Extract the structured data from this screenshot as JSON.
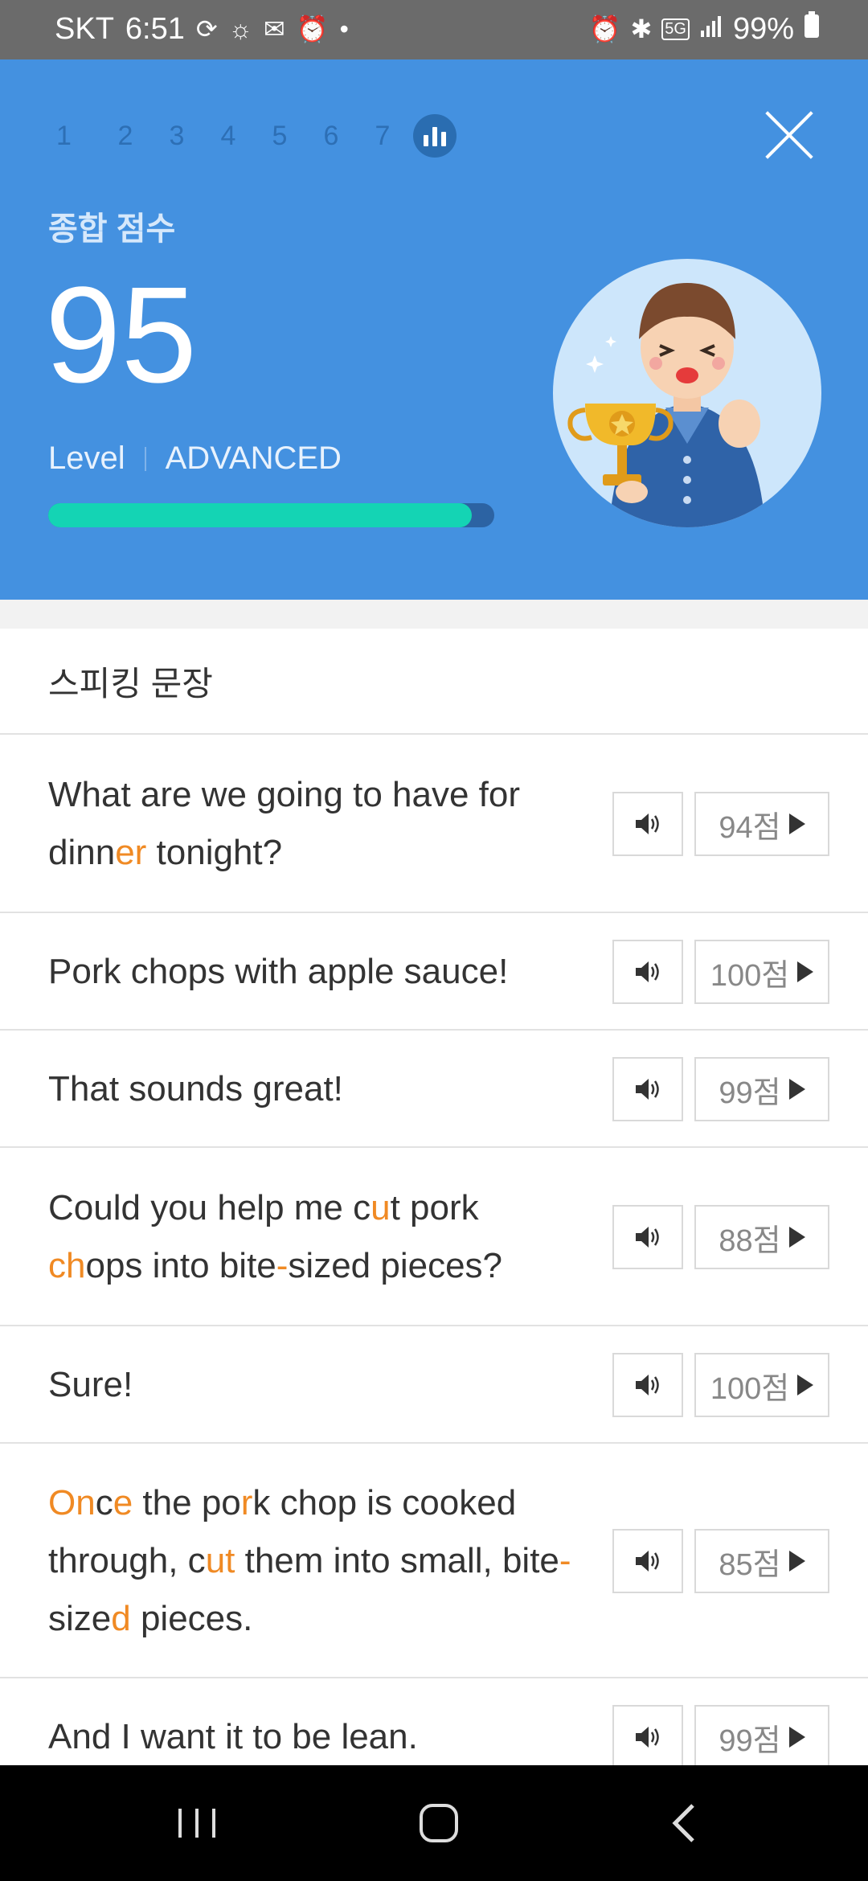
{
  "status_bar": {
    "carrier": "SKT",
    "time": "6:51",
    "battery": "99%",
    "network": "5G",
    "left_icons": [
      "sync-icon",
      "brightness-icon",
      "mail-icon",
      "alarm-icon",
      "dot-icon"
    ],
    "right_icons": [
      "alarm-icon",
      "bluetooth-icon",
      "5g-icon",
      "signal-icon",
      "battery-icon"
    ]
  },
  "hero": {
    "steps": [
      "1",
      "2",
      "3",
      "4",
      "5",
      "6",
      "7"
    ],
    "score_title": "종합 점수",
    "score": "95",
    "level_label": "Level",
    "level_value": "ADVANCED",
    "progress_fraction": 0.95,
    "colors": {
      "background": "#4491e0",
      "progress": "#14d4b4",
      "track": "#2c63a3"
    }
  },
  "section_title": "스피킹 문장",
  "sentences": [
    {
      "segments": [
        {
          "t": "What are we going to have for dinn"
        },
        {
          "t": "er",
          "h": true
        },
        {
          "t": " tonight?"
        }
      ],
      "score": "94점"
    },
    {
      "segments": [
        {
          "t": "Pork chops with apple sauce!"
        }
      ],
      "score": "100점"
    },
    {
      "segments": [
        {
          "t": "That sounds great!"
        }
      ],
      "score": "99점"
    },
    {
      "segments": [
        {
          "t": "Could you help me c"
        },
        {
          "t": "u",
          "h": true
        },
        {
          "t": "t pork "
        },
        {
          "t": "ch",
          "h": true
        },
        {
          "t": "ops into bite"
        },
        {
          "t": "-",
          "h": true
        },
        {
          "t": "sized pieces?"
        }
      ],
      "score": "88점"
    },
    {
      "segments": [
        {
          "t": "Sure!"
        }
      ],
      "score": "100점"
    },
    {
      "segments": [
        {
          "t": "O",
          "h": true
        },
        {
          "t": "n",
          "h": true
        },
        {
          "t": "c"
        },
        {
          "t": "e",
          "h": true
        },
        {
          "t": " the po"
        },
        {
          "t": "r",
          "h": true
        },
        {
          "t": "k chop is cooked through, c"
        },
        {
          "t": "ut",
          "h": true
        },
        {
          "t": " them into small, bite"
        },
        {
          "t": "-",
          "h": true
        },
        {
          "t": "size"
        },
        {
          "t": "d",
          "h": true
        },
        {
          "t": " pieces."
        }
      ],
      "score": "85점"
    },
    {
      "segments": [
        {
          "t": "And I want it to be lean."
        }
      ],
      "score": "99점"
    }
  ],
  "highlight_color": "#f08a24"
}
